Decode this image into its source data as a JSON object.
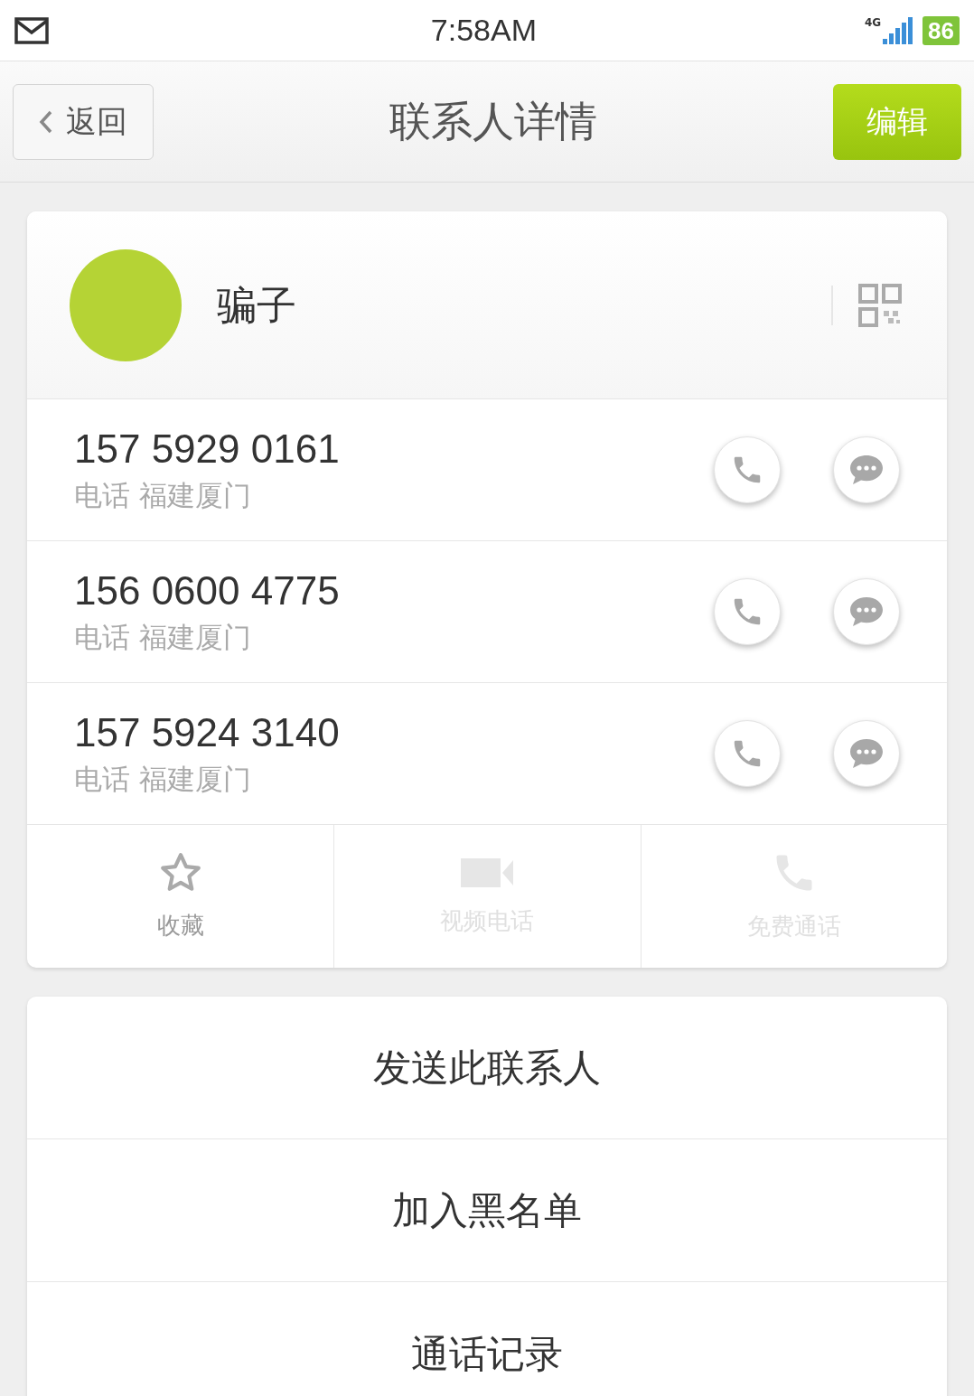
{
  "status_bar": {
    "time": "7:58AM",
    "network": "4G",
    "battery": "86"
  },
  "nav": {
    "back": "返回",
    "title": "联系人详情",
    "edit": "编辑"
  },
  "contact": {
    "name": "骗子"
  },
  "phones": [
    {
      "number": "157 5929 0161",
      "label": "电话 福建厦门"
    },
    {
      "number": "156 0600 4775",
      "label": "电话 福建厦门"
    },
    {
      "number": "157 5924 3140",
      "label": "电话 福建厦门"
    }
  ],
  "actions": [
    {
      "kind": "favorite",
      "label": "收藏",
      "disabled": false
    },
    {
      "kind": "video",
      "label": "视频电话",
      "disabled": true
    },
    {
      "kind": "free_call",
      "label": "免费通话",
      "disabled": true
    }
  ],
  "menu": [
    "发送此联系人",
    "加入黑名单",
    "通话记录"
  ]
}
